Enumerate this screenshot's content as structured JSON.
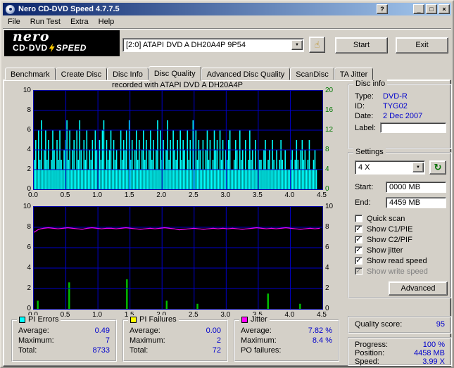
{
  "window": {
    "title": "Nero CD-DVD Speed 4.7.7.5",
    "menu": [
      "File",
      "Run Test",
      "Extra",
      "Help"
    ],
    "controls": {
      "help": "?",
      "minimize": "_",
      "maximize": "□",
      "close": "×"
    }
  },
  "icons": {
    "hand": "☝",
    "refresh": "↻",
    "dropdown": "▼",
    "check": "✓"
  },
  "logo": {
    "line1": "nero",
    "line2a": "CD·DVD",
    "line2b": "SPEED"
  },
  "toolbar": {
    "drive": "[2:0]    ATAPI DVD A  DH20A4P 9P54",
    "start": "Start",
    "exit": "Exit"
  },
  "tabs": {
    "items": [
      "Benchmark",
      "Create Disc",
      "Disc Info",
      "Disc Quality",
      "Advanced Disc Quality",
      "ScanDisc",
      "TA Jitter"
    ],
    "active": 3
  },
  "header": "recorded with ATAPI    DVD A  DH20A4P",
  "disc_info": {
    "title": "Disc info",
    "rows": [
      {
        "label": "Type:",
        "value": "DVD-R"
      },
      {
        "label": "ID:",
        "value": "TYG02"
      },
      {
        "label": "Date:",
        "value": "2 Dec 2007"
      }
    ],
    "label_label": "Label:",
    "label_value": ""
  },
  "settings": {
    "title": "Settings",
    "speed": "4 X",
    "start_label": "Start:",
    "start_value": "0000 MB",
    "end_label": "End:",
    "end_value": "4459 MB",
    "checkboxes": [
      {
        "label": "Quick scan",
        "checked": false,
        "disabled": false
      },
      {
        "label": "Show C1/PIE",
        "checked": true,
        "disabled": false
      },
      {
        "label": "Show C2/PIF",
        "checked": true,
        "disabled": false
      },
      {
        "label": "Show jitter",
        "checked": true,
        "disabled": false
      },
      {
        "label": "Show read speed",
        "checked": true,
        "disabled": false
      },
      {
        "label": "Show write speed",
        "checked": true,
        "disabled": true
      }
    ],
    "advanced": "Advanced"
  },
  "quality": {
    "label": "Quality score:",
    "value": "95"
  },
  "progress": {
    "rows": [
      {
        "label": "Progress:",
        "value": "100 %"
      },
      {
        "label": "Position:",
        "value": "4458 MB"
      },
      {
        "label": "Speed:",
        "value": "3.99 X"
      }
    ]
  },
  "legends": [
    {
      "title": "PI Errors",
      "color": "#00FFFF",
      "rows": [
        {
          "label": "Average:",
          "value": "0.49"
        },
        {
          "label": "Maximum:",
          "value": "7"
        },
        {
          "label": "Total:",
          "value": "8733"
        }
      ]
    },
    {
      "title": "PI Failures",
      "color": "#FFFF00",
      "rows": [
        {
          "label": "Average:",
          "value": "0.00"
        },
        {
          "label": "Maximum:",
          "value": "2"
        },
        {
          "label": "Total:",
          "value": "72"
        }
      ]
    },
    {
      "title": "Jitter",
      "color": "#FF00FF",
      "rows": [
        {
          "label": "Average:",
          "value": "7.82 %"
        },
        {
          "label": "Maximum:",
          "value": "8.4 %"
        },
        {
          "label": "PO failures:",
          "value": ""
        }
      ]
    }
  ],
  "chart_data": [
    {
      "type": "bar",
      "name": "pi-errors",
      "x_range": [
        0,
        4.5
      ],
      "y_max": 10,
      "data_x_end": 4.42,
      "x_ticks": [
        "0.0",
        "0.5",
        "1.0",
        "1.5",
        "2.0",
        "2.5",
        "3.0",
        "3.5",
        "4.0",
        "4.5"
      ],
      "y_left_ticks": [
        "10",
        "8",
        "6",
        "4",
        "2",
        "0"
      ],
      "y_right_ticks": [
        "20",
        "16",
        "12",
        "8",
        "4",
        "0"
      ],
      "bar_color": "#00FFFF",
      "grid_color": "#0000C8",
      "values_encoded": "35263724635236425363245736245263742536243526425367253462534226354627352463524635246352472635247352643526354263527263542524635236452635243562235426342523634252433245234253242353242223423532453423522342"
    },
    {
      "type": "line+bar",
      "name": "jitter-pif",
      "x_range": [
        0,
        4.5
      ],
      "y_max": 10,
      "data_x_end": 4.46,
      "x_ticks": [
        "0.0",
        "0.5",
        "1.0",
        "1.5",
        "2.0",
        "2.5",
        "3.0",
        "3.5",
        "4.0",
        "4.5"
      ],
      "y_ticks": [
        "10",
        "8",
        "6",
        "4",
        "2",
        "0"
      ],
      "grid_color": "#0000C8",
      "jitter_color": "#FF00FF",
      "pif_color": "#00C000",
      "jitter_values": [
        7.5,
        7.8,
        7.9,
        7.95,
        7.9,
        7.85,
        7.9,
        7.95,
        7.9,
        7.85,
        7.8,
        7.9,
        7.95,
        7.9,
        7.85,
        7.9,
        7.9,
        7.85,
        7.9,
        7.95,
        7.9,
        7.85,
        7.8,
        7.85,
        7.9,
        7.85,
        7.9,
        7.95,
        7.9,
        7.85,
        7.75,
        7.8,
        7.85,
        7.9,
        7.85,
        7.8,
        7.85,
        7.9,
        7.85,
        7.9,
        7.85,
        7.9,
        7.85,
        7.8,
        7.85,
        7.9,
        7.95,
        7.9,
        7.85,
        7.9,
        7.85,
        7.9,
        7.95,
        7.9,
        7.85,
        7.8,
        7.85,
        7.9,
        7.85,
        7.9
      ],
      "pif_spikes": [
        {
          "x": 0.06,
          "h": 0.8
        },
        {
          "x": 0.55,
          "h": 2.6
        },
        {
          "x": 1.45,
          "h": 2.9
        },
        {
          "x": 2.07,
          "h": 0.8
        },
        {
          "x": 2.55,
          "h": 0.5
        },
        {
          "x": 3.65,
          "h": 1.5
        },
        {
          "x": 4.15,
          "h": 0.5
        }
      ]
    }
  ]
}
